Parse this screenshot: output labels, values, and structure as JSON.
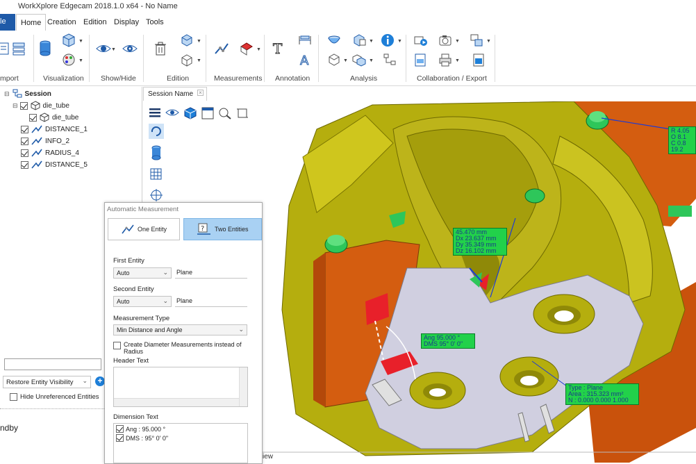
{
  "window": {
    "title": "WorkXplore Edgecam 2018.1.0 x64 - No Name"
  },
  "ribbon": {
    "tabs": [
      {
        "label": "le"
      },
      {
        "label": "Home"
      },
      {
        "label": "Creation"
      },
      {
        "label": "Edition"
      },
      {
        "label": "Display"
      },
      {
        "label": "Tools"
      }
    ],
    "groups": {
      "import": "mport",
      "visualization": "Visualization",
      "show_hide": "Show/Hide",
      "edition": "Edition",
      "measurements": "Measurements",
      "annotation": "Annotation",
      "analysis": "Analysis",
      "collab": "Collaboration / Export"
    },
    "colors": {
      "file_tab": "#1e5aa8"
    }
  },
  "tree": {
    "items": [
      {
        "label": "Session",
        "icon": "session-icon"
      },
      {
        "label": "die_tube",
        "icon": "part-icon"
      },
      {
        "label": "die_tube",
        "icon": "part-icon"
      },
      {
        "label": "DISTANCE_1",
        "icon": "measure-icon"
      },
      {
        "label": "INFO_2",
        "icon": "measure-icon"
      },
      {
        "label": "RADIUS_4",
        "icon": "measure-icon"
      },
      {
        "label": "DISTANCE_5",
        "icon": "measure-icon"
      }
    ]
  },
  "left_bottom": {
    "visibility_select": "Restore Entity Visibility",
    "hide_unreferenced": "Hide Unreferenced Entities",
    "status": "ndby"
  },
  "session_tab": {
    "label": "Session Name"
  },
  "dialog": {
    "title": "Automatic Measurement",
    "one_entity": "One Entity",
    "two_entities": "Two Entities",
    "first_entity_label": "First Entity",
    "first_entity_mode": "Auto",
    "first_entity_value": "Plane",
    "second_entity_label": "Second Entity",
    "second_entity_mode": "Auto",
    "second_entity_value": "Plane",
    "measurement_type_label": "Measurement Type",
    "measurement_type": "Min Distance and Angle",
    "diameter_checkbox": "Create Diameter Measurements instead of",
    "diameter_checkbox_2": "Radius",
    "header_text_label": "Header Text",
    "dimension_text_label": "Dimension Text",
    "dimension_lines": [
      "Ang : 95.000 °",
      "DMS : 95° 0' 0\""
    ]
  },
  "view": {
    "label_top": [
      "45.470 mm",
      "Dx  23.637 mm",
      "Dy  35.349 mm",
      "Dz  16.102 mm"
    ],
    "label_right": [
      "R  4.05",
      "O  8.1",
      "C  0.8",
      "19.2"
    ],
    "label_angle": [
      "Ang  95.000 °",
      "DMS  95° 0' 0\""
    ],
    "label_plane": [
      "Type : Plane",
      "Area : 315.323 mm²",
      "N : 0.000 0.000 1.000"
    ],
    "bottom_text": "iew",
    "colors": {
      "part": "#b9b20f",
      "orange": "#d45d10",
      "floor": "#cfcfe0",
      "label": "#22d14a"
    }
  }
}
